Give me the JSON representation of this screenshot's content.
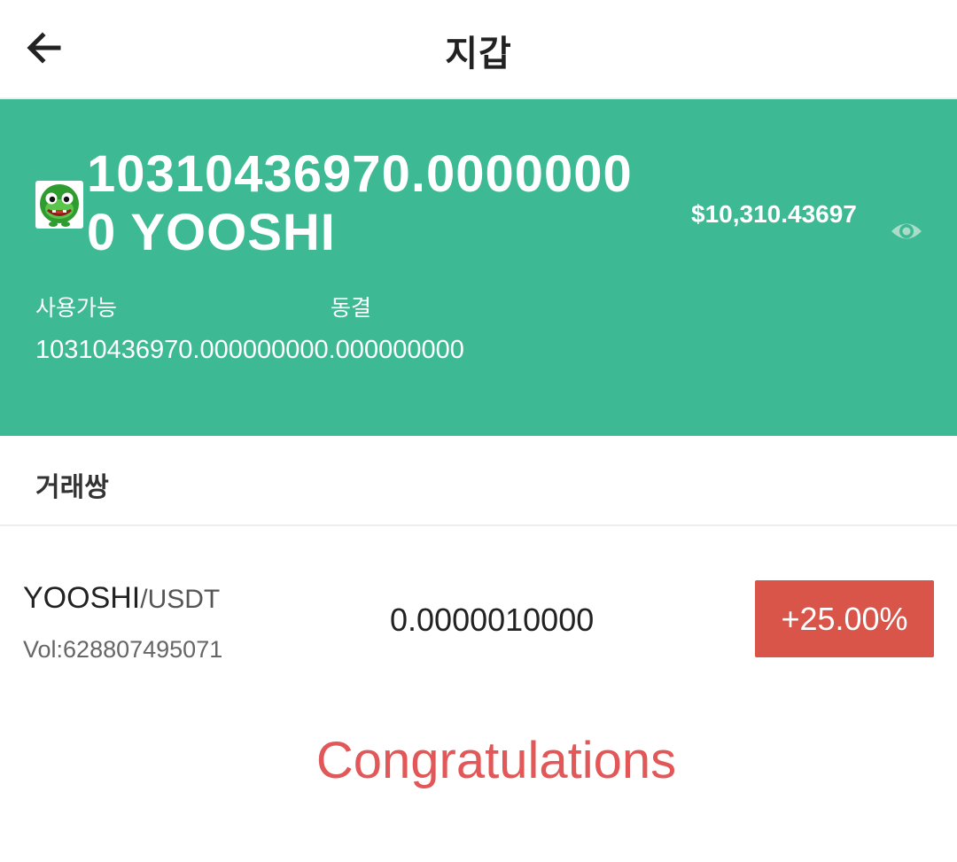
{
  "header": {
    "title": "지갑",
    "back_icon": "arrow-left-icon"
  },
  "wallet": {
    "balance": "10310436970.00000000 YOOSHI",
    "usd_value": "$10,310.43697",
    "available_label": "사용가능",
    "frozen_label": "동결",
    "amounts_text": "10310436970.000000000.000000000",
    "card_color": "#3dba94",
    "coin_logo_icon": "yooshi-logo-icon",
    "visibility_icon": "eye-icon"
  },
  "pairs_section": {
    "title": "거래쌍",
    "items": [
      {
        "base": "YOOSHI",
        "quote": "/USDT",
        "volume": "Vol:628807495071",
        "price": "0.0000010000",
        "change": "+25.00%",
        "change_color": "#d95449"
      }
    ]
  },
  "congrats_text": "Congratulations"
}
